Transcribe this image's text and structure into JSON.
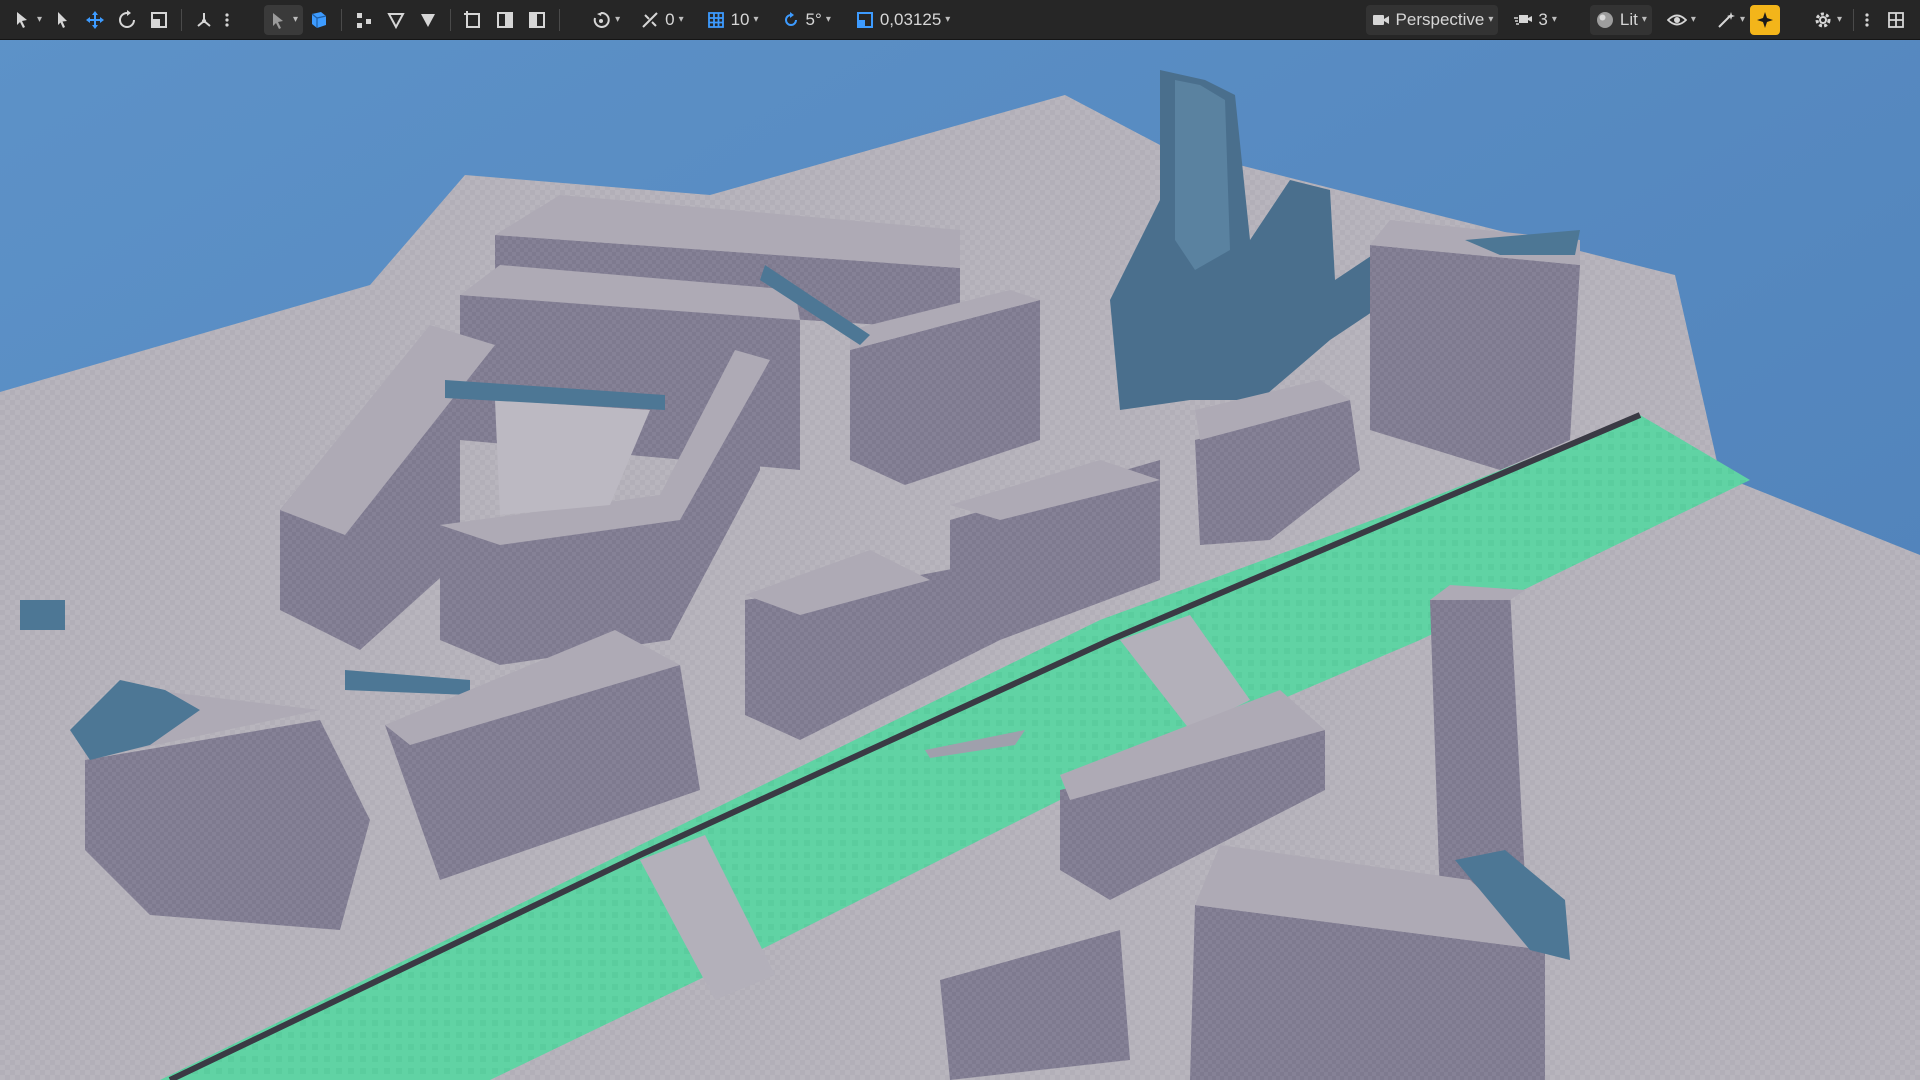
{
  "toolbar": {
    "snap_translate_value": "0",
    "grid_size_value": "10",
    "rotation_snap_value": "5°",
    "scale_snap_value": "0,03125",
    "view_mode_label": "Perspective",
    "camera_speed_value": "3",
    "lighting_mode_label": "Lit"
  },
  "colors": {
    "sky": "#5c8fc6",
    "ground": "#b9b6bd",
    "building_top": "#aeaab5",
    "building_side": "#837f92",
    "water": "#5fd2a3",
    "accent_props": "#4d7795",
    "toolbar_bg": "#262626",
    "realtime_toggle": "#f3b51a"
  }
}
